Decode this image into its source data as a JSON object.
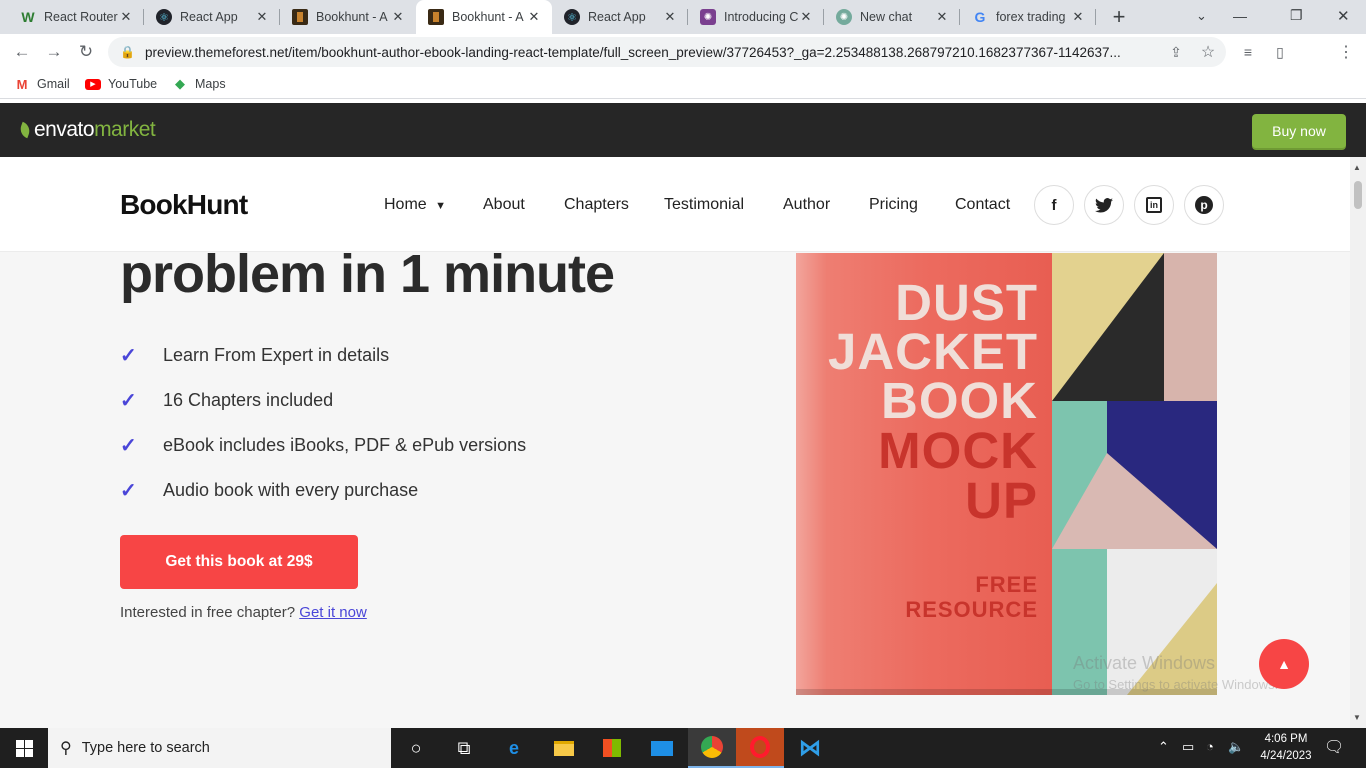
{
  "browser": {
    "tabs": [
      {
        "title": "React Router",
        "icon": "w-icon",
        "active": false
      },
      {
        "title": "React App",
        "icon": "react-icon",
        "active": false
      },
      {
        "title": "Bookhunt - A",
        "icon": "bookhunt-icon",
        "active": false
      },
      {
        "title": "Bookhunt - A",
        "icon": "bookhunt-icon",
        "active": true
      },
      {
        "title": "React App",
        "icon": "react-icon",
        "active": false
      },
      {
        "title": "Introducing C",
        "icon": "openai-icon",
        "active": false
      },
      {
        "title": "New chat",
        "icon": "chatgpt-icon",
        "active": false
      },
      {
        "title": "forex trading",
        "icon": "google-icon",
        "active": false
      }
    ],
    "new_tab_label": "+",
    "url": "preview.themeforest.net/item/bookhunt-author-ebook-landing-react-template/full_screen_preview/37726453?_ga=2.253488138.268797210.1682377367-1142637...",
    "bookmarks": [
      {
        "label": "Gmail",
        "icon": "gmail-icon"
      },
      {
        "label": "YouTube",
        "icon": "youtube-icon"
      },
      {
        "label": "Maps",
        "icon": "maps-icon"
      }
    ]
  },
  "envato": {
    "logo_word": "envato",
    "logo_market": "market",
    "buy_label": "Buy now",
    "accent": "#82b440"
  },
  "site": {
    "brand": "BookHunt",
    "nav": [
      "Home",
      "About",
      "Chapters",
      "Testimonial",
      "Author",
      "Pricing",
      "Contact"
    ],
    "social": [
      "facebook-icon",
      "twitter-icon",
      "linkedin-icon",
      "pinterest-icon"
    ],
    "headline": "problem in 1 minute",
    "features": [
      "Learn From Expert in details",
      "16 Chapters included",
      "eBook includes iBooks, PDF & ePub versions",
      "Audio book with every purchase"
    ],
    "cta_label": "Get this book at 29$",
    "free_text": "Interested in free chapter?",
    "free_link": "Get it now",
    "accent": "#f74545",
    "check_color": "#4a46d8"
  },
  "book": {
    "line1": "DUST",
    "line2": "JACKET",
    "line3": "BOOK",
    "line4": "MOCK",
    "line5": "UP",
    "footer1": "FREE",
    "footer2": "RESOURCE"
  },
  "watermark": {
    "line1": "Activate Windows",
    "line2": "Go to Settings to activate Windows."
  },
  "taskbar": {
    "search_placeholder": "Type here to search",
    "time": "4:06 PM",
    "date": "4/24/2023"
  }
}
